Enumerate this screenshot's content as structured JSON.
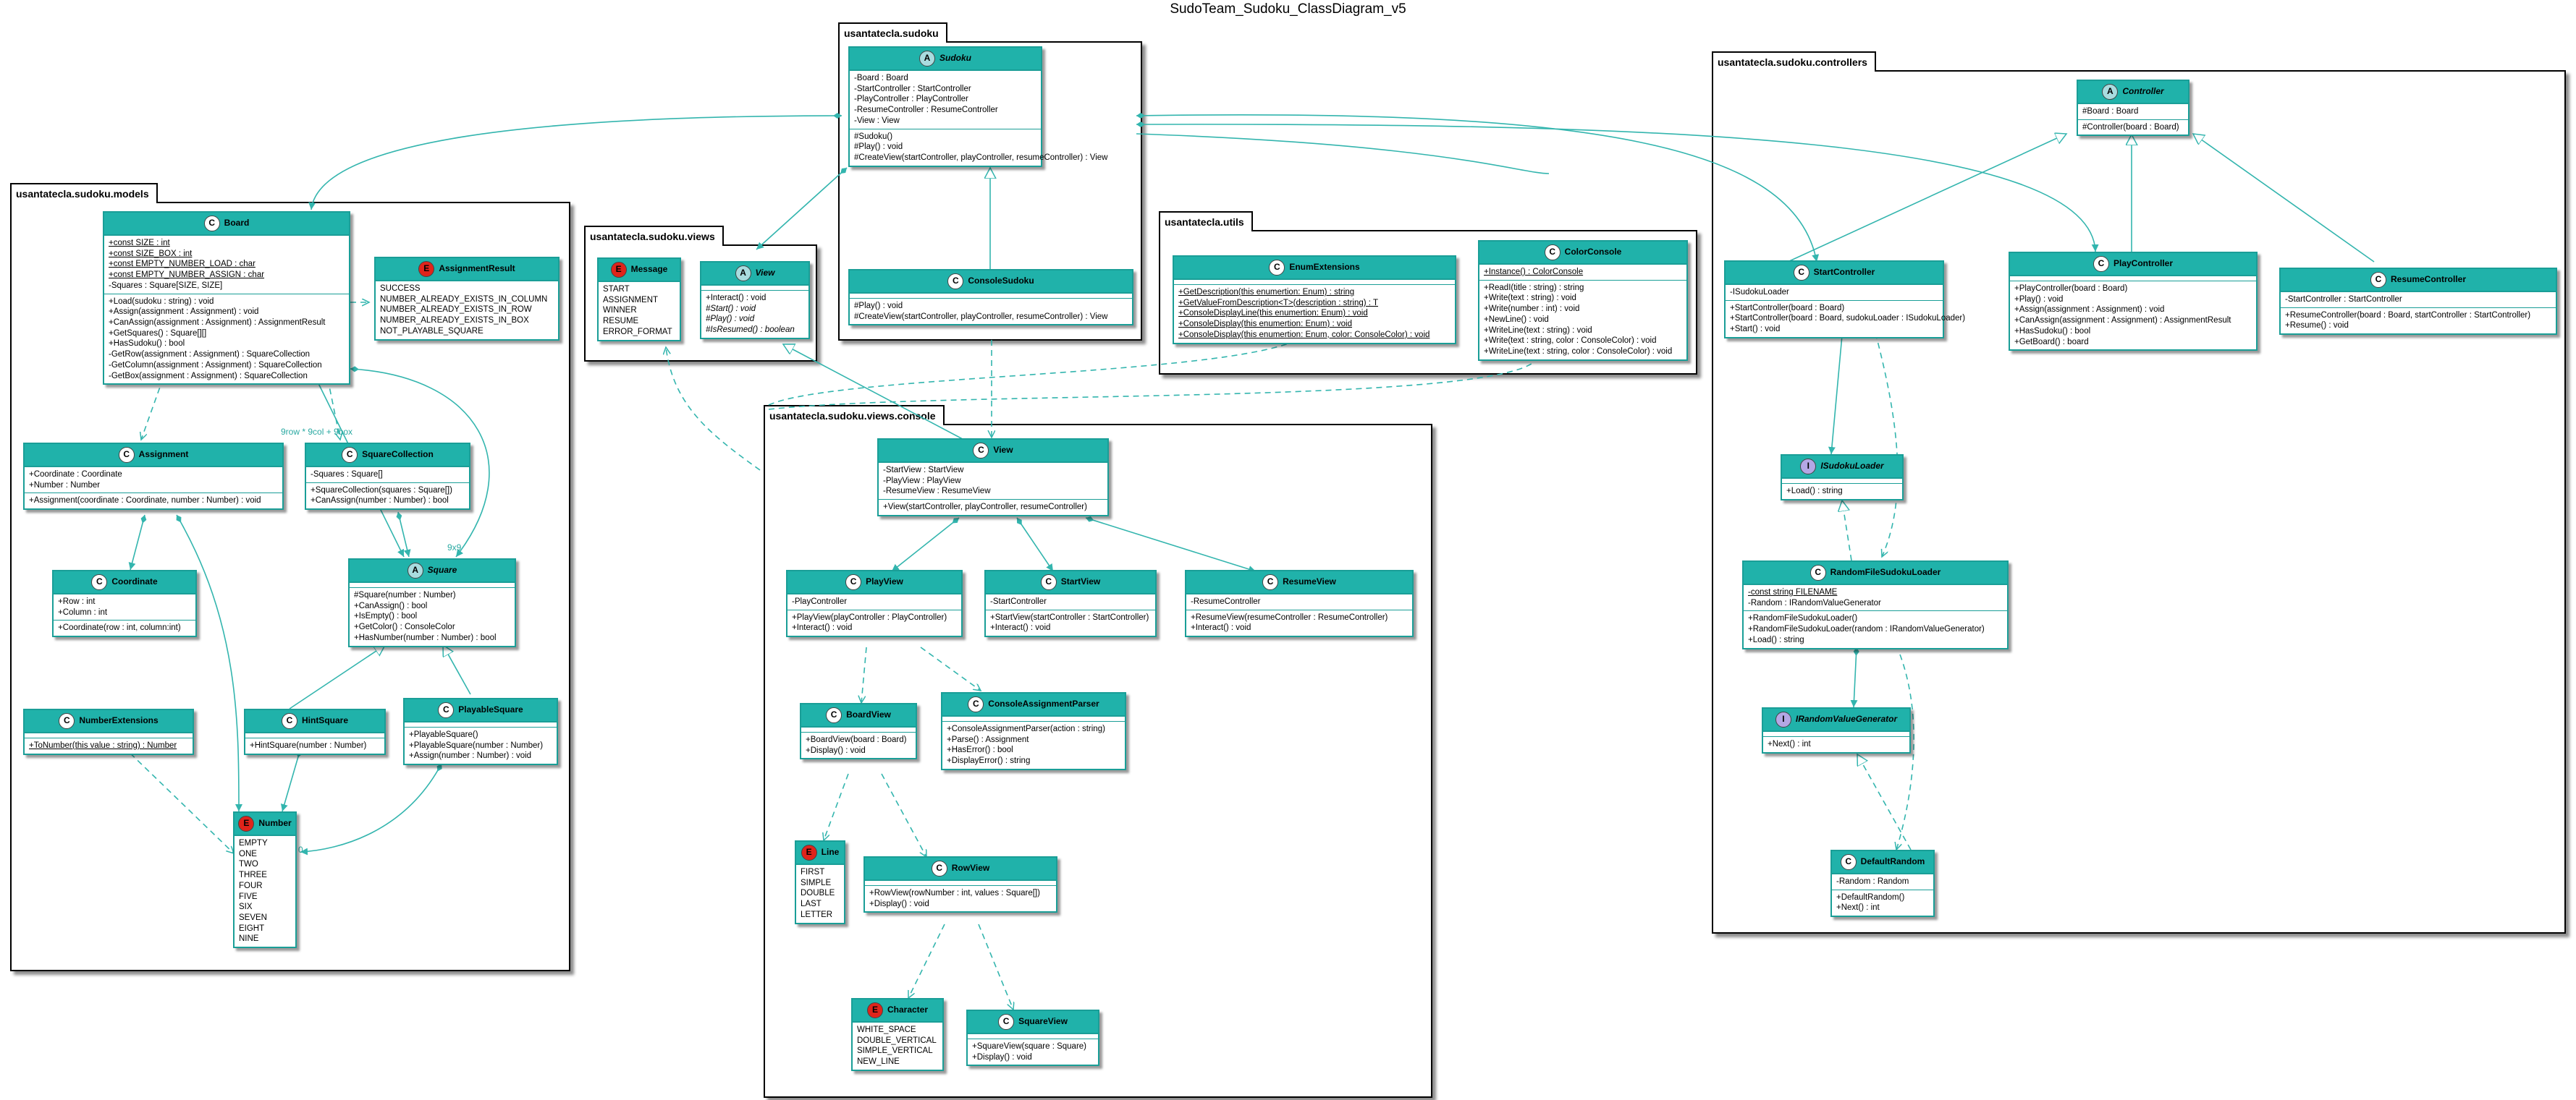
{
  "title": "SudoTeam_Sudoku_ClassDiagram_v5",
  "colors": {
    "header": "#20b2aa",
    "border": "#1a9e97",
    "edge": "#33b5ae"
  },
  "packages": {
    "sudoku": "usantatecla.sudoku",
    "controllers": "usantatecla.sudoku.controllers",
    "models": "usantatecla.sudoku.models",
    "views": "usantatecla.sudoku.views",
    "utils": "usantatecla.utils",
    "console": "usantatecla.sudoku.views.console"
  },
  "multiplicities": {
    "board_squares_left": "9row * 9col + 9box",
    "board_squares_right": "9x9",
    "number_zero": "0"
  },
  "classes": {
    "Sudoku": {
      "badge": "A",
      "name": "Sudoku",
      "fields": [
        "-Board : Board",
        "-StartController : StartController",
        "-PlayController : PlayController",
        "-ResumeController : ResumeController",
        "-View : View"
      ],
      "methods": [
        "#Sudoku()",
        "#Play() : void",
        "#CreateView(startController, playController, resumeController) : View"
      ]
    },
    "ConsoleSudoku": {
      "badge": "C",
      "name": "ConsoleSudoku",
      "fields": [],
      "methods": [
        "#Play() : void",
        "#CreateView(startController, playController, resumeController) : View"
      ]
    },
    "Controller": {
      "badge": "A",
      "name": "Controller",
      "fields": [
        "#Board : Board"
      ],
      "methods": [
        "#Controller(board : Board)"
      ]
    },
    "StartController": {
      "badge": "C",
      "name": "StartController",
      "fields": [
        "-ISudokuLoader"
      ],
      "methods": [
        "+StartController(board : Board)",
        "+StartController(board : Board, sudokuLoader : ISudokuLoader)",
        "+Start() : void"
      ]
    },
    "PlayController": {
      "badge": "C",
      "name": "PlayController",
      "fields": [],
      "methods": [
        "+PlayController(board : Board)",
        "+Play() : void",
        "+Assign(assignment : Assignment) : void",
        "+CanAssign(assignment : Assignment) : AssignmentResult",
        "+HasSudoku() : bool",
        "+GetBoard() : board"
      ]
    },
    "ResumeController": {
      "badge": "C",
      "name": "ResumeController",
      "fields": [
        "-StartController : StartController"
      ],
      "methods": [
        "+ResumeController(board : Board, startController : StartController)",
        "+Resume() : void"
      ]
    },
    "ISudokuLoader": {
      "badge": "I",
      "name": "ISudokuLoader",
      "fields": [],
      "methods": [
        "+Load() : string"
      ]
    },
    "RandomFileSudokuLoader": {
      "badge": "C",
      "name": "RandomFileSudokuLoader",
      "fields": [
        "-const string FILENAME",
        "-Random : IRandomValueGenerator"
      ],
      "methods": [
        "+RandomFileSudokuLoader()",
        "+RandomFileSudokuLoader(random : IRandomValueGenerator)",
        "+Load() : string"
      ]
    },
    "IRandomValueGenerator": {
      "badge": "I",
      "name": "IRandomValueGenerator",
      "fields": [],
      "methods": [
        "+Next() : int"
      ]
    },
    "DefaultRandom": {
      "badge": "C",
      "name": "DefaultRandom",
      "fields": [
        "-Random : Random"
      ],
      "methods": [
        "+DefaultRandom()",
        "+Next() : int"
      ]
    },
    "Board": {
      "badge": "C",
      "name": "Board",
      "fields": [
        "+const SIZE : int",
        "+const SIZE_BOX : int",
        "+const EMPTY_NUMBER_LOAD : char",
        "+const EMPTY_NUMBER_ASSIGN : char",
        "-Squares : Square[SIZE, SIZE]"
      ],
      "methods": [
        "+Load(sudoku : string) : void",
        "+Assign(assignment : Assignment) : void",
        "+CanAssign(assignment : Assignment) : AssignmentResult",
        "+GetSquares() : Square[][]",
        "+HasSudoku() : bool",
        "-GetRow(assignment : Assignment) : SquareCollection",
        "-GetColumn(assignment : Assignment) : SquareCollection",
        "-GetBox(assignment : Assignment) : SquareCollection"
      ]
    },
    "AssignmentResult": {
      "badge": "E",
      "name": "AssignmentResult",
      "fields": [
        "SUCCESS",
        "NUMBER_ALREADY_EXISTS_IN_COLUMN",
        "NUMBER_ALREADY_EXISTS_IN_ROW",
        "NUMBER_ALREADY_EXISTS_IN_BOX",
        "NOT_PLAYABLE_SQUARE"
      ],
      "methods": []
    },
    "Assignment": {
      "badge": "C",
      "name": "Assignment",
      "fields": [
        "+Coordinate : Coordinate",
        "+Number : Number"
      ],
      "methods": [
        "+Assignment(coordinate : Coordinate, number : Number) : void"
      ]
    },
    "SquareCollection": {
      "badge": "C",
      "name": "SquareCollection",
      "fields": [
        "-Squares : Square[]"
      ],
      "methods": [
        "+SquareCollection(squares : Square[])",
        "+CanAssign(number : Number) : bool"
      ]
    },
    "Coordinate": {
      "badge": "C",
      "name": "Coordinate",
      "fields": [
        "+Row : int",
        "+Column : int"
      ],
      "methods": [
        "+Coordinate(row : int, column:int)"
      ]
    },
    "Square": {
      "badge": "A",
      "name": "Square",
      "fields": [],
      "methods": [
        "#Square(number : Number)",
        "+CanAssign() : bool",
        "+IsEmpty() : bool",
        "+GetColor() : ConsoleColor",
        "+HasNumber(number : Number) : bool"
      ]
    },
    "NumberExtensions": {
      "badge": "C",
      "name": "NumberExtensions",
      "fields": [],
      "methods": [
        "+ToNumber(this value : string) : Number"
      ]
    },
    "HintSquare": {
      "badge": "C",
      "name": "HintSquare",
      "fields": [],
      "methods": [
        "+HintSquare(number : Number)"
      ]
    },
    "PlayableSquare": {
      "badge": "C",
      "name": "PlayableSquare",
      "fields": [],
      "methods": [
        "+PlayableSquare()",
        "+PlayableSquare(number : Number)",
        "+Assign(number : Number) : void"
      ]
    },
    "Number": {
      "badge": "E",
      "name": "Number",
      "fields": [
        "EMPTY",
        "ONE",
        "TWO",
        "THREE",
        "FOUR",
        "FIVE",
        "SIX",
        "SEVEN",
        "EIGHT",
        "NINE"
      ],
      "methods": []
    },
    "Message": {
      "badge": "E",
      "name": "Message",
      "fields": [
        "START",
        "ASSIGNMENT",
        "WINNER",
        "RESUME",
        "ERROR_FORMAT"
      ],
      "methods": []
    },
    "AView": {
      "badge": "A",
      "name": "View",
      "fields": [],
      "methods": [
        "+Interact() : void",
        "#Start() : void",
        "#Play() : void",
        "#IsResumed() : boolean"
      ]
    },
    "EnumExtensions": {
      "badge": "C",
      "name": "EnumExtensions",
      "fields": [],
      "methods": [
        "+GetDescription(this enumertion: Enum) : string",
        "+GetValueFromDescription<T>(description : string) : T",
        "+ConsoleDisplayLine(this enumertion: Enum) : void",
        "+ConsoleDisplay(this enumertion: Enum) : void",
        "+ConsoleDisplay(this enumertion: Enum, color: ConsoleColor) : void"
      ]
    },
    "ColorConsole": {
      "badge": "C",
      "name": "ColorConsole",
      "fields": [
        "+Instance() : ColorConsole"
      ],
      "methods": [
        "+ReadI(title : string) : string",
        "+Write(text : string) : void",
        "+Write(number : int) : void",
        "+NewLine() : void",
        "+WriteLine(text : string) : void",
        "+Write(text : string, color : ConsoleColor) : void",
        "+WriteLine(text : string, color : ConsoleColor) : void"
      ]
    },
    "CView": {
      "badge": "C",
      "name": "View",
      "fields": [
        "-StartView : StartView",
        "-PlayView : PlayView",
        "-ResumeView : ResumeView"
      ],
      "methods": [
        "+View(startController, playController, resumeController)"
      ]
    },
    "PlayView": {
      "badge": "C",
      "name": "PlayView",
      "fields": [
        "-PlayController"
      ],
      "methods": [
        "+PlayView(playController : PlayController)",
        "+Interact() : void"
      ]
    },
    "StartView": {
      "badge": "C",
      "name": "StartView",
      "fields": [
        "-StartController"
      ],
      "methods": [
        "+StartView(startController : StartController)",
        "+Interact() : void"
      ]
    },
    "ResumeView": {
      "badge": "C",
      "name": "ResumeView",
      "fields": [
        "-ResumeController"
      ],
      "methods": [
        "+ResumeView(resumeController : ResumeController)",
        "+Interact() : void"
      ]
    },
    "BoardView": {
      "badge": "C",
      "name": "BoardView",
      "fields": [],
      "methods": [
        "+BoardView(board : Board)",
        "+Display() : void"
      ]
    },
    "ConsoleAssignmentParser": {
      "badge": "C",
      "name": "ConsoleAssignmentParser",
      "fields": [],
      "methods": [
        "+ConsoleAssignmentParser(action : string)",
        "+Parse() : Assignment",
        "+HasError() : bool",
        "+DisplayError() : string"
      ]
    },
    "Line": {
      "badge": "E",
      "name": "Line",
      "fields": [
        "FIRST",
        "SIMPLE",
        "DOUBLE",
        "LAST",
        "LETTER"
      ],
      "methods": []
    },
    "RowView": {
      "badge": "C",
      "name": "RowView",
      "fields": [],
      "methods": [
        "+RowView(rowNumber : int, values : Square[])",
        "+Display() : void"
      ]
    },
    "Character": {
      "badge": "E",
      "name": "Character",
      "fields": [
        "WHITE_SPACE",
        "DOUBLE_VERTICAL",
        "SIMPLE_VERTICAL",
        "NEW_LINE"
      ],
      "methods": []
    },
    "SquareView": {
      "badge": "C",
      "name": "SquareView",
      "fields": [],
      "methods": [
        "+SquareView(square : Square)",
        "+Display() : void"
      ]
    }
  }
}
